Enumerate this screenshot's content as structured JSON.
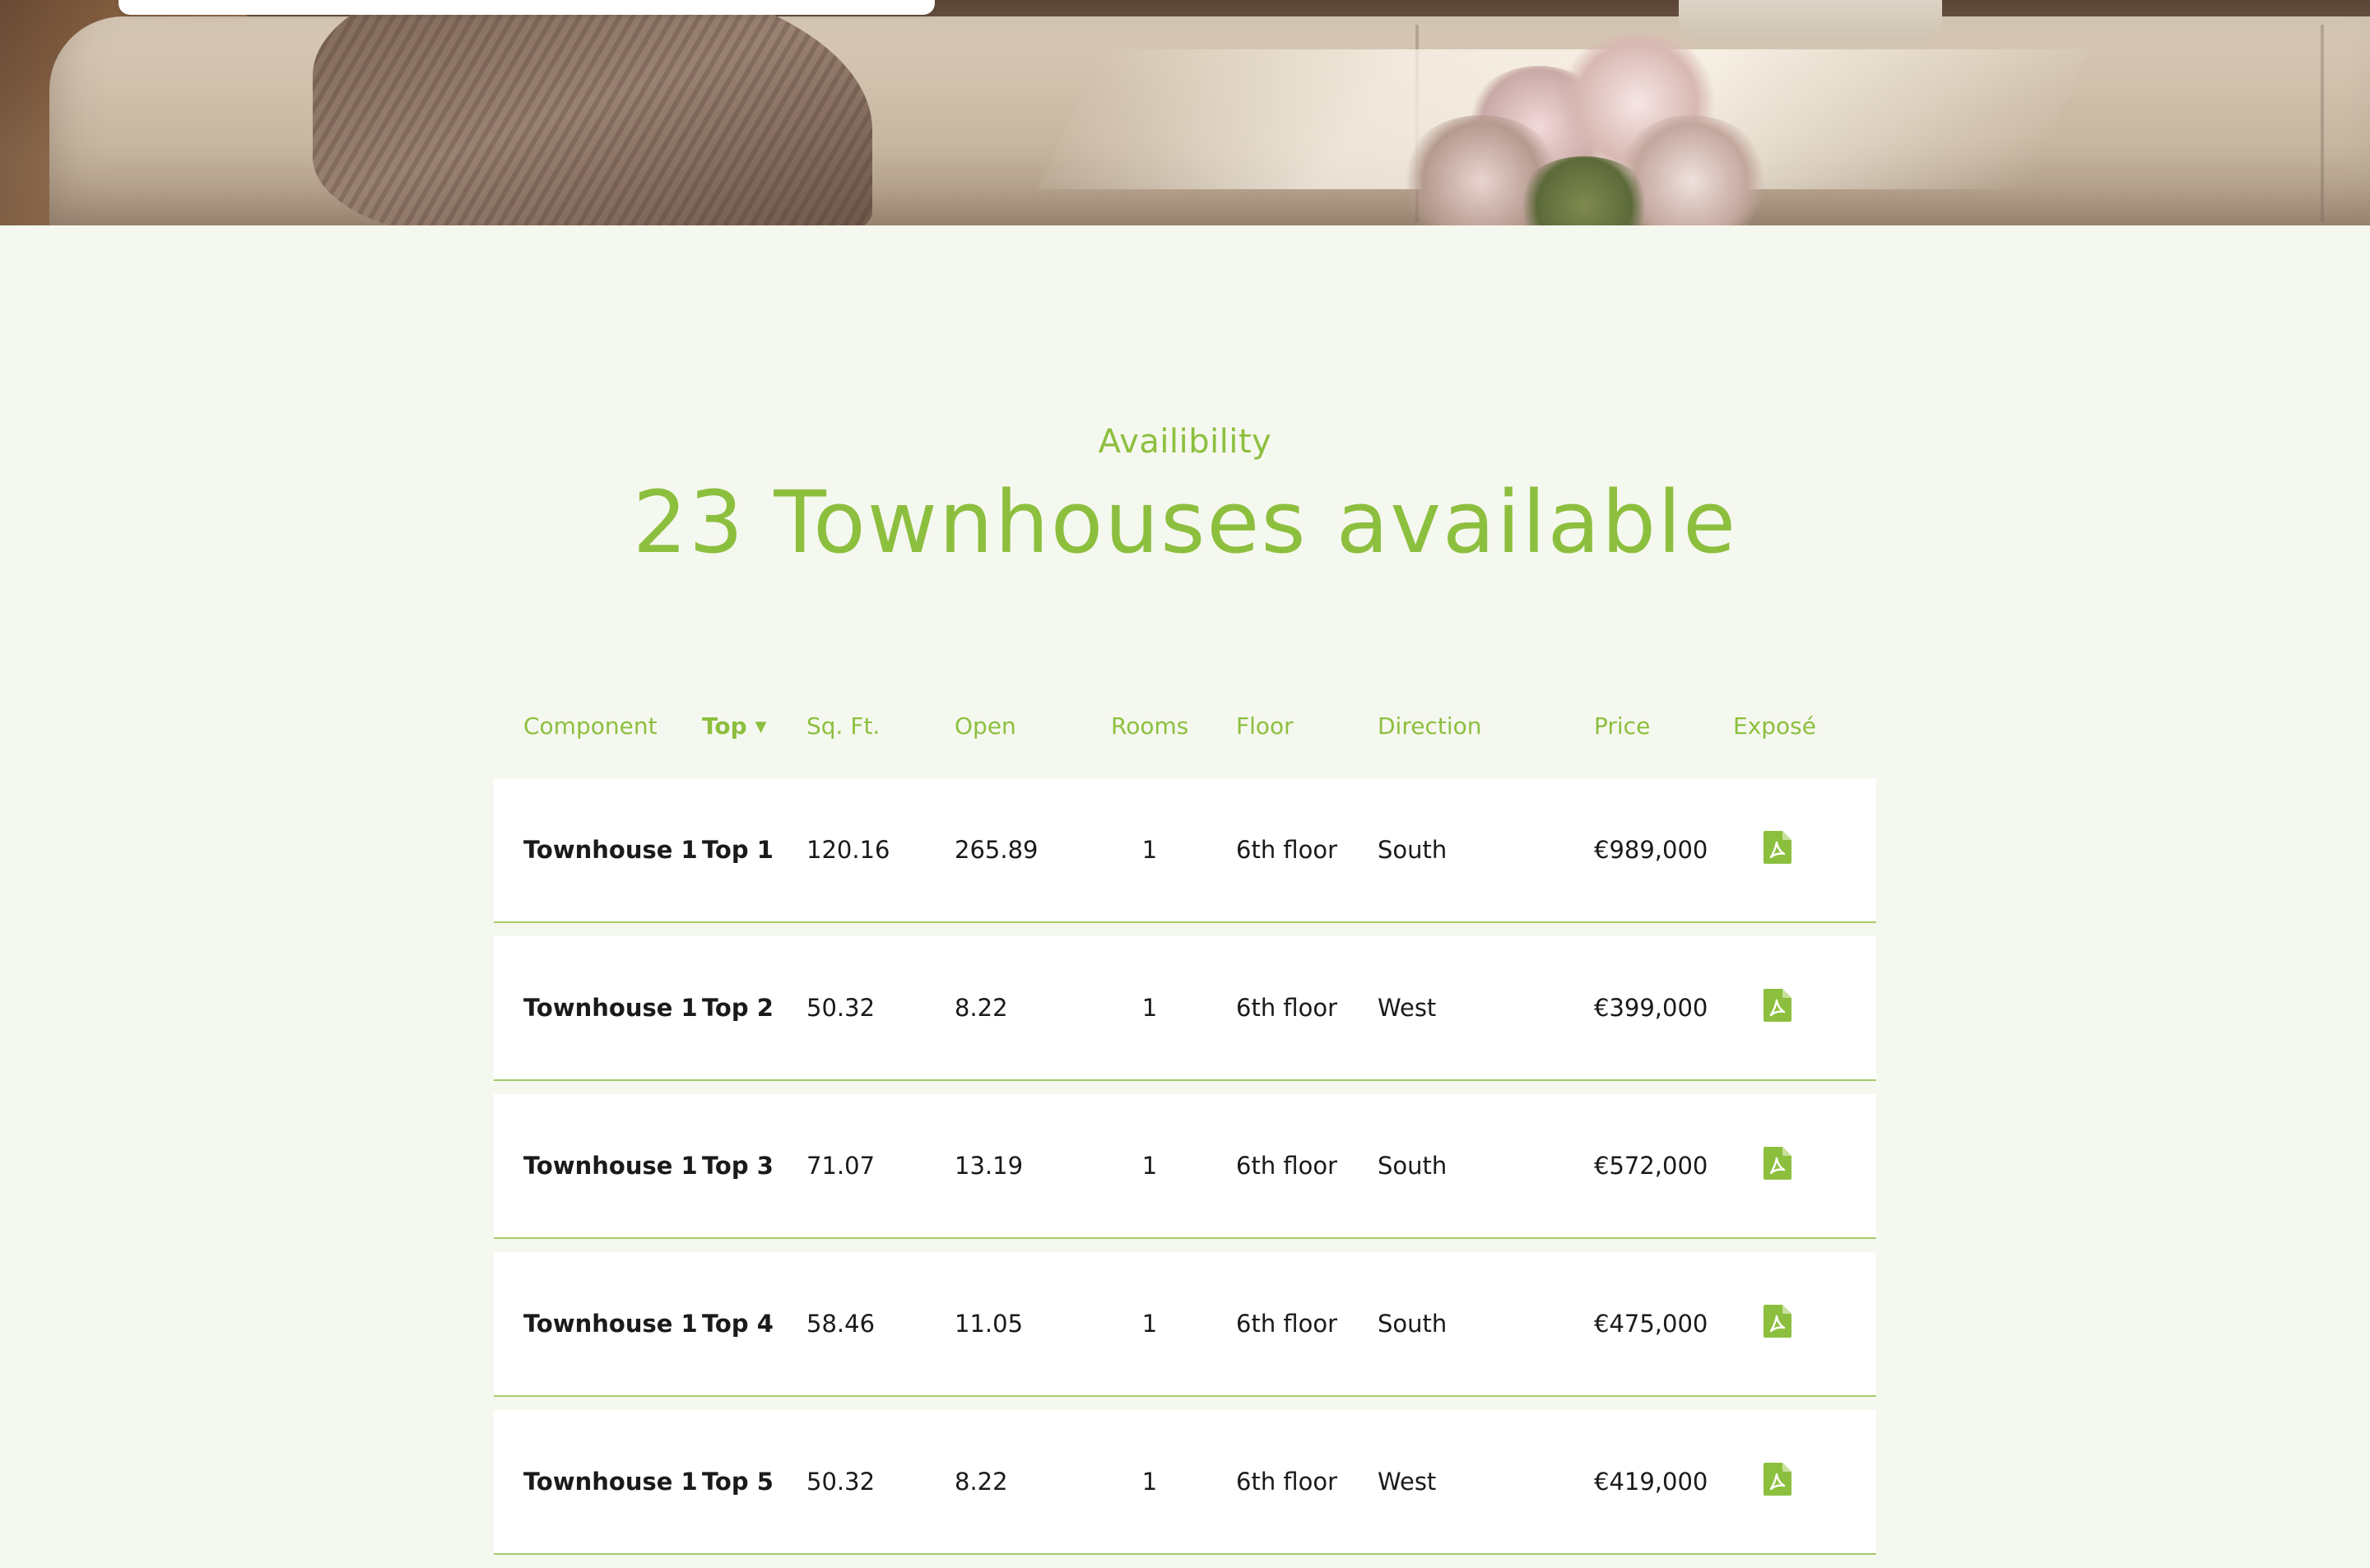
{
  "section": {
    "eyebrow": "Availibility",
    "title": "23 Townhouses available"
  },
  "table": {
    "columns": {
      "component": "Component",
      "top": "Top",
      "sqft": "Sq. Ft.",
      "open": "Open",
      "rooms": "Rooms",
      "floor": "Floor",
      "direction": "Direction",
      "price": "Price",
      "expose": "Exposé"
    },
    "sort": {
      "column": "top",
      "direction": "descending",
      "icon": "caret-down-icon"
    },
    "rows": [
      {
        "component": "Townhouse 1",
        "top": "Top 1",
        "sqft": "120.16",
        "open": "265.89",
        "rooms": "1",
        "floor": "6th floor",
        "direction": "South",
        "price": "€989,000",
        "icon": "pdf-icon"
      },
      {
        "component": "Townhouse 1",
        "top": "Top 2",
        "sqft": "50.32",
        "open": "8.22",
        "rooms": "1",
        "floor": "6th floor",
        "direction": "West",
        "price": "€399,000",
        "icon": "pdf-icon"
      },
      {
        "component": "Townhouse 1",
        "top": "Top 3",
        "sqft": "71.07",
        "open": "13.19",
        "rooms": "1",
        "floor": "6th floor",
        "direction": "South",
        "price": "€572,000",
        "icon": "pdf-icon"
      },
      {
        "component": "Townhouse 1",
        "top": "Top 4",
        "sqft": "58.46",
        "open": "11.05",
        "rooms": "1",
        "floor": "6th floor",
        "direction": "South",
        "price": "€475,000",
        "icon": "pdf-icon"
      },
      {
        "component": "Townhouse 1",
        "top": "Top 5",
        "sqft": "50.32",
        "open": "8.22",
        "rooms": "1",
        "floor": "6th floor",
        "direction": "West",
        "price": "€419,000",
        "icon": "pdf-icon"
      }
    ]
  },
  "colors": {
    "accent": "#8dbf3f",
    "background": "#f5f8ef",
    "row_background": "#ffffff",
    "row_divider": "#a6cc6a",
    "text": "#1a1a1a"
  }
}
